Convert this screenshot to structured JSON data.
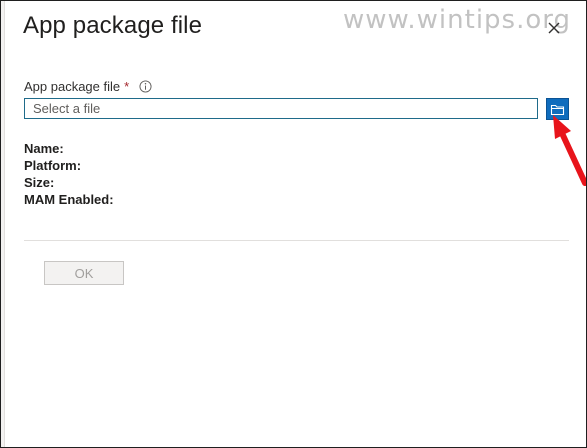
{
  "dialog": {
    "title": "App package file",
    "close_icon": "close-icon"
  },
  "watermark": {
    "text": "www.wintips.org"
  },
  "file_field": {
    "label": "App package file",
    "required_marker": "*",
    "info_icon": "info-icon",
    "placeholder": "Select a file",
    "value": "",
    "browse_icon": "folder-icon"
  },
  "details": {
    "name_label": "Name:",
    "platform_label": "Platform:",
    "size_label": "Size:",
    "mam_label": "MAM Enabled:"
  },
  "footer": {
    "ok_label": "OK",
    "ok_disabled": true
  },
  "colors": {
    "accent": "#0f6cbd",
    "input_border": "#1f6b8a",
    "required": "#a4262c",
    "annotation_arrow": "#e8141b"
  }
}
